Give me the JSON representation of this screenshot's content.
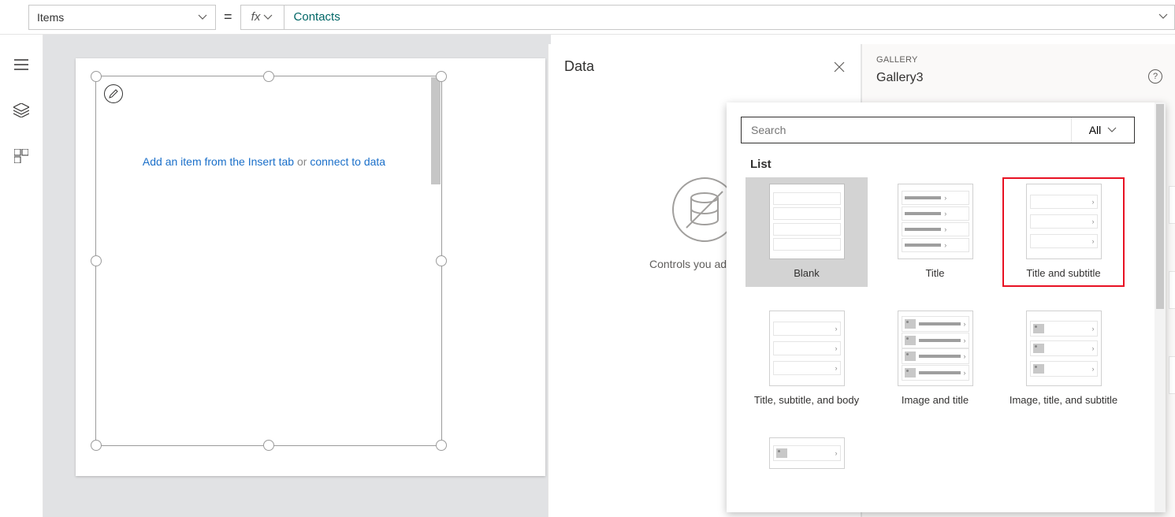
{
  "formula_bar": {
    "property": "Items",
    "equals": "=",
    "fx": "fx",
    "expression": "Contacts"
  },
  "canvas": {
    "hint_before": "Add an item from the Insert tab",
    "hint_or": " or ",
    "hint_link": "connect to data"
  },
  "data_pane": {
    "title": "Data",
    "empty_text": "Controls you add will s"
  },
  "properties_pane": {
    "crumb": "GALLERY",
    "title": "Gallery3",
    "help": "?"
  },
  "layout_flyout": {
    "search_placeholder": "Search",
    "all_label": "All",
    "section": "List",
    "layouts": [
      {
        "label": "Blank"
      },
      {
        "label": "Title"
      },
      {
        "label": "Title and subtitle"
      },
      {
        "label": "Title, subtitle, and body"
      },
      {
        "label": "Image and title"
      },
      {
        "label": "Image, title, and subtitle"
      }
    ]
  }
}
